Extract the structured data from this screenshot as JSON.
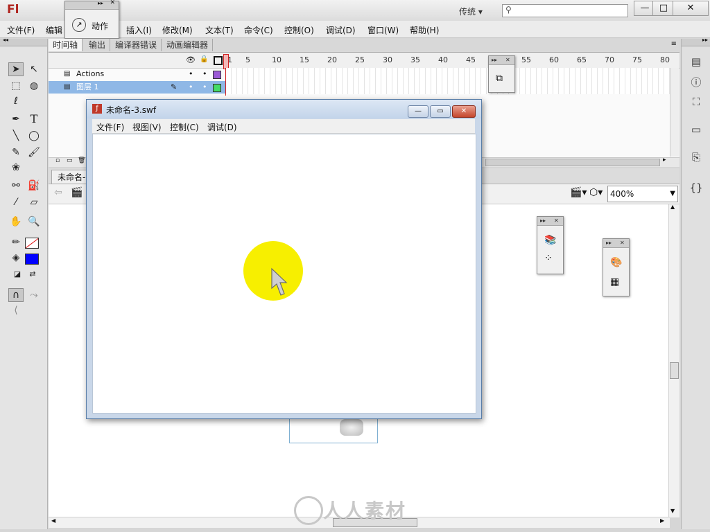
{
  "app": {
    "logo": "Fl",
    "workspace": "传统",
    "search_placeholder": "",
    "window_controls": {
      "minimize": "—",
      "maximize": "□",
      "close": "✕"
    }
  },
  "menus": [
    "文件(F)",
    "编辑",
    "插入(I)",
    "修改(M)",
    "文本(T)",
    "命令(C)",
    "控制(O)",
    "调试(D)",
    "窗口(W)",
    "帮助(H)"
  ],
  "actions_panel": {
    "label": "动作",
    "icon": "actions-arrow-icon"
  },
  "timeline": {
    "tabs": [
      "时间轴",
      "输出",
      "编译器错误",
      "动画编辑器"
    ],
    "frame_numbers": [
      "1",
      "5",
      "10",
      "15",
      "20",
      "25",
      "30",
      "35",
      "40",
      "45",
      "50",
      "55",
      "60",
      "65",
      "70",
      "75",
      "80"
    ],
    "layers": [
      {
        "name": "Actions",
        "color": "#9b59d6",
        "selected": false
      },
      {
        "name": "图层 1",
        "color": "#44dd66",
        "selected": true
      }
    ],
    "header_icons": [
      "eye-icon",
      "lock-icon",
      "outline-icon"
    ]
  },
  "scene": {
    "tab": "未命名-"
  },
  "zoom": {
    "value": "400%"
  },
  "swf_window": {
    "title": "未命名-3.swf",
    "menus": [
      "文件(F)",
      "视图(V)",
      "控制(C)",
      "调试(D)"
    ],
    "controls": {
      "minimize": "—",
      "maximize": "▭",
      "close": "✕"
    },
    "circle_color": "#f7ef00"
  },
  "toolbox": {
    "icons": [
      "selection-arrow-icon",
      "subselection-icon",
      "free-transform-icon",
      "3d-rotation-icon",
      "lasso-icon",
      "pen-icon",
      "text-icon",
      "line-icon",
      "oval-icon",
      "pencil-icon",
      "brush-icon",
      "deco-icon",
      "bone-icon",
      "paint-bucket-icon",
      "eyedropper-icon",
      "eraser-icon",
      "hand-icon",
      "zoom-icon",
      "stroke-color-icon",
      "fill-color-icon",
      "snap-magnet-icon"
    ],
    "fill_color": "#0000ff",
    "stroke_color": "none"
  },
  "watermark": {
    "text": "人人素材"
  }
}
